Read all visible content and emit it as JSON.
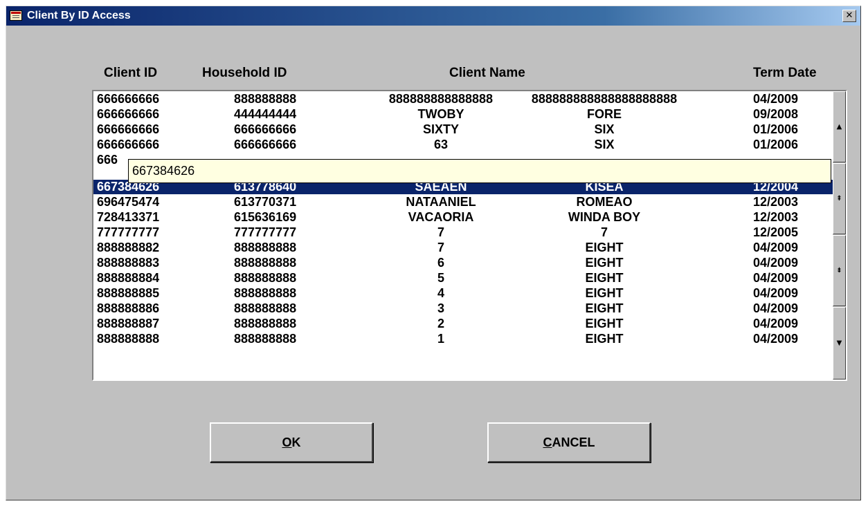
{
  "window": {
    "title": "Client By ID Access",
    "close_glyph": "✕",
    "icon": "app-window-icon"
  },
  "columns": {
    "client_id": "Client ID",
    "household_id": "Household ID",
    "client_name": "Client Name",
    "term_date": "Term Date"
  },
  "rows": [
    {
      "client_id": "666666666",
      "household_id": "888888888",
      "first": "888888888888888",
      "last": "888888888888888888888",
      "term_date": "04/2009"
    },
    {
      "client_id": "666666666",
      "household_id": "444444444",
      "first": "TWOBY",
      "last": "FORE",
      "term_date": "09/2008"
    },
    {
      "client_id": "666666666",
      "household_id": "666666666",
      "first": "SIXTY",
      "last": "SIX",
      "term_date": "01/2006"
    },
    {
      "client_id": "666666666",
      "household_id": "666666666",
      "first": "63",
      "last": "SIX",
      "term_date": "01/2006"
    },
    {
      "client_id": "666",
      "household_id": "",
      "first": "",
      "last": "",
      "term_date": ""
    },
    {
      "client_id": "667384626",
      "household_id": "613778640",
      "first": "SAEAEN",
      "last": "KISEA",
      "term_date": "12/2004",
      "selected": true
    },
    {
      "client_id": "696475474",
      "household_id": "613770371",
      "first": "NATAANIEL",
      "last": "ROMEAO",
      "term_date": "12/2003"
    },
    {
      "client_id": "728413371",
      "household_id": "615636169",
      "first": "VACAORIA",
      "last": "WINDA BOY",
      "term_date": "12/2003"
    },
    {
      "client_id": "777777777",
      "household_id": "777777777",
      "first": "7",
      "last": "7",
      "term_date": "12/2005"
    },
    {
      "client_id": "888888882",
      "household_id": "888888888",
      "first": "7",
      "last": "EIGHT",
      "term_date": "04/2009"
    },
    {
      "client_id": "888888883",
      "household_id": "888888888",
      "first": "6",
      "last": "EIGHT",
      "term_date": "04/2009"
    },
    {
      "client_id": "888888884",
      "household_id": "888888888",
      "first": "5",
      "last": "EIGHT",
      "term_date": "04/2009"
    },
    {
      "client_id": "888888885",
      "household_id": "888888888",
      "first": "4",
      "last": "EIGHT",
      "term_date": "04/2009"
    },
    {
      "client_id": "888888886",
      "household_id": "888888888",
      "first": "3",
      "last": "EIGHT",
      "term_date": "04/2009"
    },
    {
      "client_id": "888888887",
      "household_id": "888888888",
      "first": "2",
      "last": "EIGHT",
      "term_date": "04/2009"
    },
    {
      "client_id": "888888888",
      "household_id": "888888888",
      "first": "1",
      "last": "EIGHT",
      "term_date": "04/2009"
    }
  ],
  "tooltip": {
    "text": "667384626"
  },
  "scrollbar": {
    "up": "▲",
    "page_up": "⇞",
    "page_down": "⇟",
    "down": "▼"
  },
  "buttons": {
    "ok_mnemonic": "O",
    "ok_rest": "K",
    "cancel_mnemonic": "C",
    "cancel_rest": "ANCEL"
  },
  "colors": {
    "selection": "#0a246a",
    "face": "#c0c0c0",
    "tooltip": "#ffffe1"
  }
}
